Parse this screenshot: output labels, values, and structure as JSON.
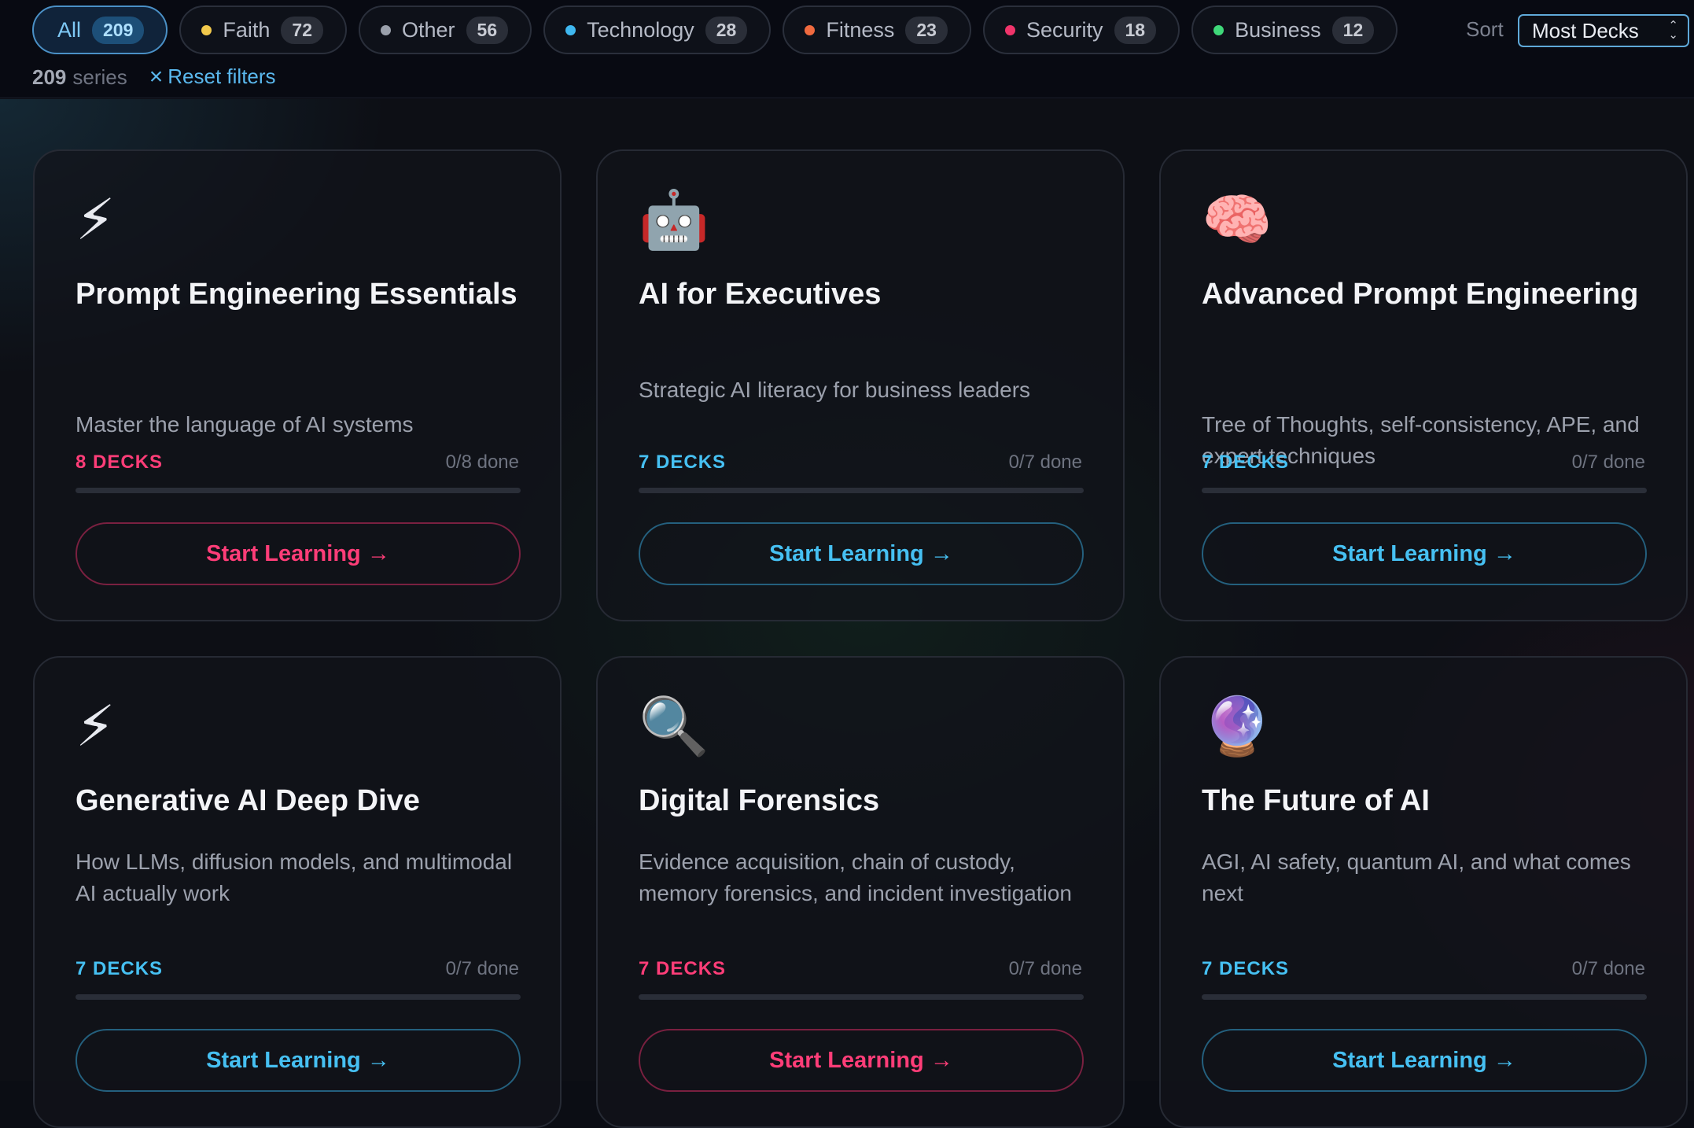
{
  "filters": [
    {
      "label": "All",
      "count": "209",
      "dot": ""
    },
    {
      "label": "Faith",
      "count": "72",
      "dot": "#f2c94c"
    },
    {
      "label": "Other",
      "count": "56",
      "dot": "#9aa0ab"
    },
    {
      "label": "Technology",
      "count": "28",
      "dot": "#3fb8f0"
    },
    {
      "label": "Fitness",
      "count": "23",
      "dot": "#f06a3f"
    },
    {
      "label": "Security",
      "count": "18",
      "dot": "#f0346a"
    },
    {
      "label": "Business",
      "count": "12",
      "dot": "#3fd879"
    }
  ],
  "sort": {
    "label": "Sort",
    "value": "Most Decks"
  },
  "meta": {
    "count": "209",
    "unit": "series",
    "reset": "Reset filters"
  },
  "colors": {
    "pink": "#ff3d78",
    "blue": "#46c0f2"
  },
  "cards": [
    {
      "emoji": "⚡",
      "icon": "lightning-icon",
      "title": "Prompt Engineering Essentials",
      "desc": "Master the language of AI systems",
      "decks": "8 DECKS",
      "done": "0/8 done",
      "progress": 0,
      "cta": "Start Learning →",
      "accent": "pink"
    },
    {
      "emoji": "🤖",
      "icon": "robot-icon",
      "title": "AI for Executives",
      "desc": "Strategic AI literacy for business leaders",
      "decks": "7 DECKS",
      "done": "0/7 done",
      "progress": 0,
      "cta": "Start Learning →",
      "accent": "blue"
    },
    {
      "emoji": "🧠",
      "icon": "brain-icon",
      "title": "Advanced Prompt Engineering",
      "desc": "Tree of Thoughts, self-consistency, APE, and expert techniques",
      "decks": "7 DECKS",
      "done": "0/7 done",
      "progress": 0,
      "cta": "Start Learning →",
      "accent": "blue"
    },
    {
      "emoji": "⚡",
      "icon": "lightning-icon",
      "title": "Generative AI Deep Dive",
      "desc": "How LLMs, diffusion models, and multimodal AI actually work",
      "decks": "7 DECKS",
      "done": "0/7 done",
      "progress": 0,
      "cta": "Start Learning →",
      "accent": "blue"
    },
    {
      "emoji": "🔍",
      "icon": "magnifier-icon",
      "title": "Digital Forensics",
      "desc": "Evidence acquisition, chain of custody, memory forensics, and incident investigation",
      "decks": "7 DECKS",
      "done": "0/7 done",
      "progress": 0,
      "cta": "Start Learning →",
      "accent": "pink"
    },
    {
      "emoji": "🔮",
      "icon": "crystal-ball-icon",
      "title": "The Future of AI",
      "desc": "AGI, AI safety, quantum AI, and what comes next",
      "decks": "7 DECKS",
      "done": "0/7 done",
      "progress": 0,
      "cta": "Start Learning →",
      "accent": "blue"
    }
  ]
}
